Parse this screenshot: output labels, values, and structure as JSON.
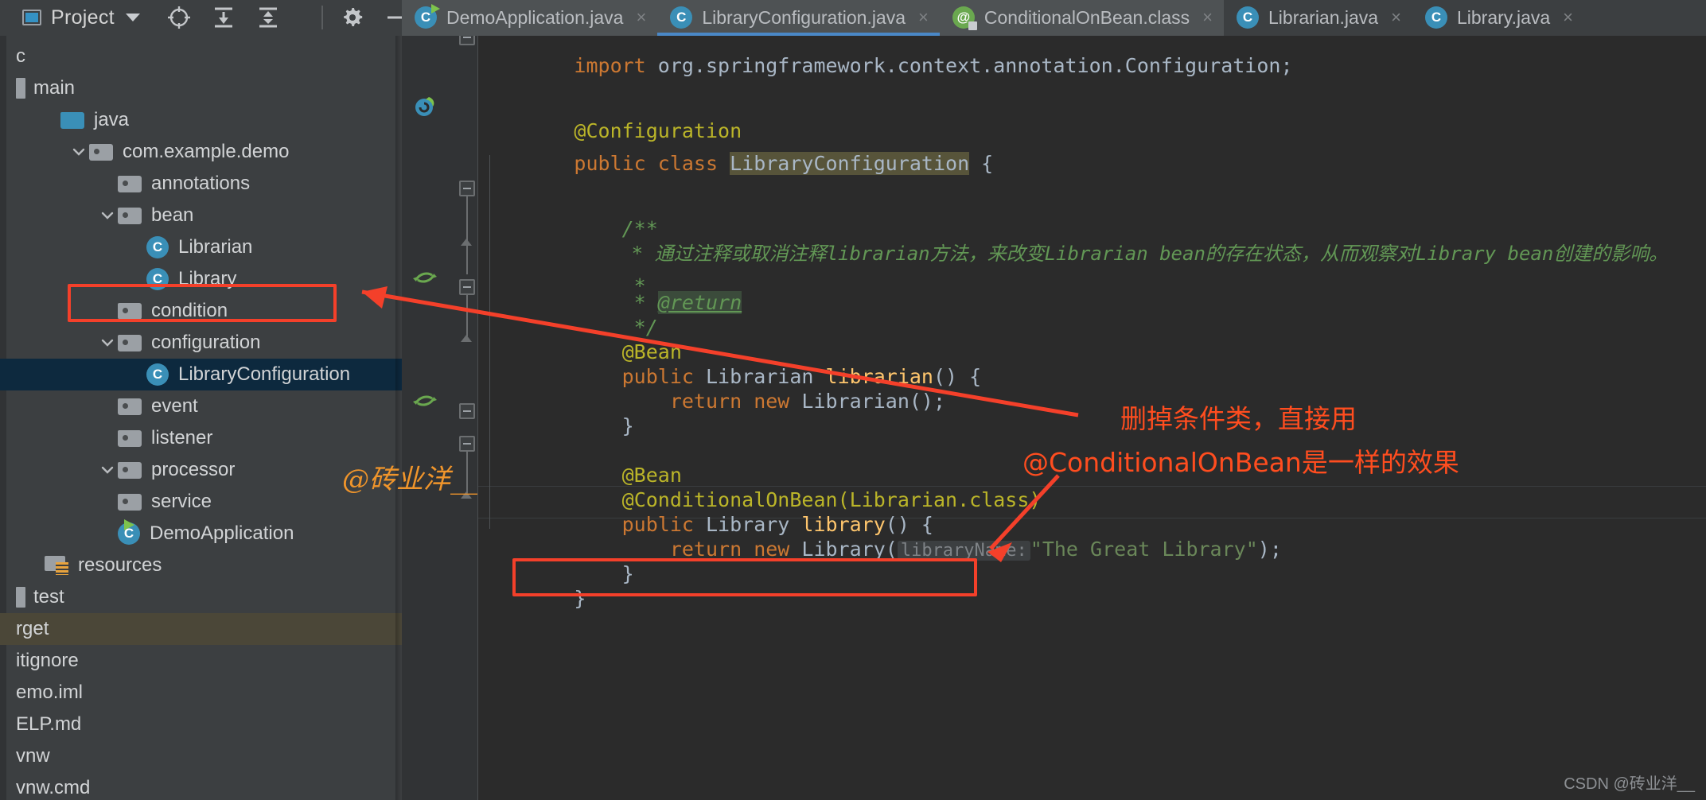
{
  "toolbar": {
    "project_label": "Project",
    "project_icon": "project-window-icon",
    "dropdown_icon": "chevron-down-icon",
    "icons": [
      {
        "name": "locate-target-icon",
        "title": "Select Opened File"
      },
      {
        "name": "expand-all-icon",
        "title": "Expand All"
      },
      {
        "name": "collapse-all-icon",
        "title": "Collapse All"
      },
      {
        "name": "gear-icon",
        "title": "Options"
      },
      {
        "name": "minimize-icon",
        "title": "Hide"
      }
    ]
  },
  "tabs": [
    {
      "label": "DemoApplication.java",
      "icon": "spring-class-icon",
      "active": false,
      "close_glyph": "×"
    },
    {
      "label": "LibraryConfiguration.java",
      "icon": "java-class-icon",
      "active": true,
      "close_glyph": "×"
    },
    {
      "label": "ConditionalOnBean.class",
      "icon": "annotation-readonly-icon",
      "active": false,
      "close_glyph": "×"
    },
    {
      "label": "Librarian.java",
      "icon": "java-class-icon",
      "active": false,
      "close_glyph": "×"
    },
    {
      "label": "Library.java",
      "icon": "java-class-icon",
      "active": false,
      "close_glyph": "×"
    }
  ],
  "sidebar": {
    "rows": [
      {
        "label": "c",
        "indent": 0,
        "icon": "none",
        "arrow": "none",
        "state": "normal",
        "clipped": true
      },
      {
        "label": "main",
        "indent": 0,
        "icon": "module-bar",
        "arrow": "none",
        "state": "normal",
        "clipped": true
      },
      {
        "label": "java",
        "indent": 1,
        "icon": "folder-blue",
        "arrow": "none",
        "state": "normal"
      },
      {
        "label": "com.example.demo",
        "indent": 2,
        "icon": "folder-pkg",
        "arrow": "expanded",
        "state": "normal"
      },
      {
        "label": "annotations",
        "indent": 3,
        "icon": "folder-pkg",
        "arrow": "none",
        "state": "normal"
      },
      {
        "label": "bean",
        "indent": 3,
        "icon": "folder-pkg",
        "arrow": "expanded",
        "state": "normal"
      },
      {
        "label": "Librarian",
        "indent": 4,
        "icon": "class",
        "arrow": "none",
        "state": "normal"
      },
      {
        "label": "Library",
        "indent": 4,
        "icon": "class",
        "arrow": "none",
        "state": "normal"
      },
      {
        "label": "condition",
        "indent": 3,
        "icon": "folder-pkg",
        "arrow": "none",
        "state": "boxed"
      },
      {
        "label": "configuration",
        "indent": 3,
        "icon": "folder-pkg",
        "arrow": "expanded",
        "state": "normal"
      },
      {
        "label": "LibraryConfiguration",
        "indent": 4,
        "icon": "class",
        "arrow": "none",
        "state": "selected"
      },
      {
        "label": "event",
        "indent": 3,
        "icon": "folder-pkg",
        "arrow": "none",
        "state": "normal"
      },
      {
        "label": "listener",
        "indent": 3,
        "icon": "folder-pkg",
        "arrow": "none",
        "state": "normal"
      },
      {
        "label": "processor",
        "indent": 3,
        "icon": "folder-pkg",
        "arrow": "expanded",
        "state": "normal"
      },
      {
        "label": "service",
        "indent": 3,
        "icon": "folder-pkg",
        "arrow": "none",
        "state": "normal"
      },
      {
        "label": "DemoApplication",
        "indent": 3,
        "icon": "spring-class",
        "arrow": "none",
        "state": "normal"
      },
      {
        "label": "resources",
        "indent": 1,
        "icon": "folder-res",
        "arrow": "none",
        "state": "normal",
        "clipped": true
      },
      {
        "label": "test",
        "indent": 0,
        "icon": "module-bar",
        "arrow": "none",
        "state": "normal",
        "clipped": true
      },
      {
        "label": "rget",
        "indent": 0,
        "icon": "none",
        "arrow": "none",
        "state": "amber",
        "clipped": true
      },
      {
        "label": "itignore",
        "indent": 0,
        "icon": "none",
        "arrow": "none",
        "state": "normal",
        "clipped": true
      },
      {
        "label": "emo.iml",
        "indent": 0,
        "icon": "none",
        "arrow": "none",
        "state": "normal",
        "clipped": true
      },
      {
        "label": "ELP.md",
        "indent": 0,
        "icon": "none",
        "arrow": "none",
        "state": "normal",
        "clipped": true
      },
      {
        "label": "vnw",
        "indent": 0,
        "icon": "none",
        "arrow": "none",
        "state": "normal",
        "clipped": true
      },
      {
        "label": "vnw.cmd",
        "indent": 0,
        "icon": "none",
        "arrow": "none",
        "state": "normal",
        "clipped": true
      }
    ]
  },
  "editor": {
    "file": "LibraryConfiguration.java",
    "lines": {
      "import": "import org.springframework.context.annotation.Configuration;",
      "blank": "",
      "anno_config": "@Configuration",
      "class_kw": "public class ",
      "class_name": "LibraryConfiguration",
      "class_brace": " {",
      "doc_open": "    /**",
      "doc_cn": "     * 通过注释或取消注释librarian方法，来改变Librarian bean的存在状态，从而观察对Library bean创建的影响。",
      "doc_star": "     *",
      "doc_return_pre": "     * ",
      "doc_return_tag": "@return",
      "doc_close": "     */",
      "anno_bean_1": "    @Bean",
      "m1_sig_kw": "    public ",
      "m1_sig_type": "Librarian ",
      "m1_sig_name": "librarian",
      "m1_sig_rest": "() {",
      "m1_ret_kw": "        return new ",
      "m1_ret_type": "Librarian",
      "m1_ret_rest": "();",
      "m1_close": "    }",
      "anno_bean_2": "    @Bean",
      "anno_cond": "@ConditionalOnBean(Librarian.class)",
      "anno_cond_prefix": "    ",
      "m2_sig_kw": "    public ",
      "m2_sig_type": "Library ",
      "m2_sig_name": "library",
      "m2_sig_rest": "() {",
      "m2_ret_kw": "        return new ",
      "m2_ret_type": "Library",
      "m2_ret_open": "(",
      "m2_hint": "libraryName:",
      "m2_str": "\"The Great Library\"",
      "m2_ret_close": ");",
      "m2_close": "    }",
      "class_close": "}"
    }
  },
  "annotations": {
    "note_line_1": "删掉条件类，直接用",
    "note_line_2": "@ConditionalOnBean是一样的效果",
    "watermark": "@砖业洋__",
    "credit": "CSDN @砖业洋__",
    "accent_color": "#ff4d1f",
    "box_color": "#f4402a",
    "watermark_color": "#f0952b"
  }
}
